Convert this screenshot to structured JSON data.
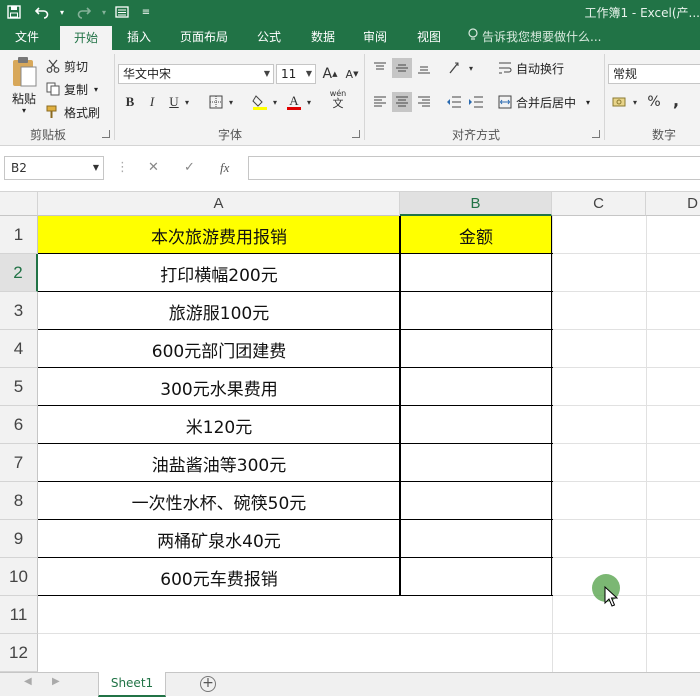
{
  "titlebar": {
    "title": "工作簿1 - Excel(产...",
    "save_icon": "save-icon",
    "undo_icon": "undo-icon",
    "redo_icon": "redo-icon",
    "form_icon": "form-icon",
    "accent": "#217346"
  },
  "tabs": [
    {
      "label": "文件"
    },
    {
      "label": "开始"
    },
    {
      "label": "插入"
    },
    {
      "label": "页面布局"
    },
    {
      "label": "公式"
    },
    {
      "label": "数据"
    },
    {
      "label": "审阅"
    },
    {
      "label": "视图"
    }
  ],
  "tellme": "告诉我您想要做什么...",
  "clipboard": {
    "paste": "粘贴",
    "cut": "剪切",
    "copy": "复制",
    "format_painter": "格式刷",
    "group": "剪贴板"
  },
  "font": {
    "name": "华文中宋",
    "size": "11",
    "grow": "A",
    "shrink": "A",
    "bold": "B",
    "italic": "I",
    "underline": "U",
    "group": "字体",
    "wen": "wén"
  },
  "alignment": {
    "wrap": "自动换行",
    "merge": "合并后居中",
    "group": "对齐方式"
  },
  "number": {
    "format": "常规",
    "percent": "%",
    "comma": ",",
    "group": "数字"
  },
  "formula_bar": {
    "name_box": "B2",
    "cancel": "✕",
    "enter": "✓",
    "fx": "fx",
    "value": ""
  },
  "columns": [
    "A",
    "B",
    "C",
    "D"
  ],
  "rows": [
    "1",
    "2",
    "3",
    "4",
    "5",
    "6",
    "7",
    "8",
    "9",
    "10",
    "11",
    "12"
  ],
  "table": {
    "header": [
      "本次旅游费用报销",
      "金额"
    ],
    "items": [
      "打印横幅200元",
      "旅游服100元",
      "600元部门团建费",
      "300元水果费用",
      "米120元",
      "油盐酱油等300元",
      "一次性水杯、碗筷50元",
      "两桶矿泉水40元",
      "600元车费报销"
    ],
    "header_fill": "#ffff00"
  },
  "sheet": {
    "tab": "Sheet1",
    "add": "+"
  }
}
